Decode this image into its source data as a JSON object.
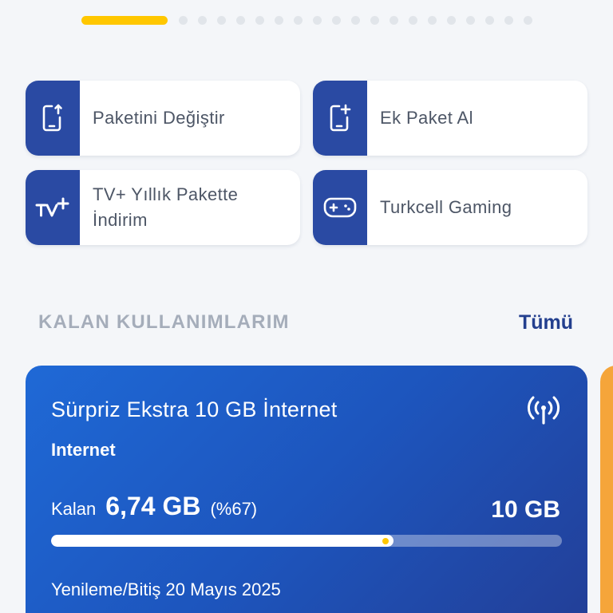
{
  "pager": {
    "total_pages": 20,
    "current_page": 1
  },
  "actions": [
    {
      "label": "Paketini Değiştir",
      "icon": "phone-upgrade-icon"
    },
    {
      "label": "Ek Paket Al",
      "icon": "phone-add-icon"
    },
    {
      "label": "TV+ Yıllık Pakette İndirim",
      "icon": "tv-plus-icon"
    },
    {
      "label": "Turkcell Gaming",
      "icon": "gamepad-icon"
    }
  ],
  "section": {
    "title": "KALAN KULLANIMLARIM",
    "see_all": "Tümü"
  },
  "usage_card": {
    "title": "Sürpriz Ekstra 10 GB İnternet",
    "type": "Internet",
    "remaining_label": "Kalan",
    "remaining_value": "6,74 GB",
    "remaining_percent": "(%67)",
    "total": "10 GB",
    "progress_fraction": 0.67,
    "renewal": "Yenileme/Bitiş 20 Mayıs 2025",
    "icon": "antenna-signal-icon"
  },
  "colors": {
    "accent": "#ffc700",
    "brand_blue": "#2a4aa3",
    "link": "#233f8e",
    "card_gradient_start": "#1f69d6",
    "card_gradient_end": "#233e96",
    "next_card": "#f5a53a"
  }
}
